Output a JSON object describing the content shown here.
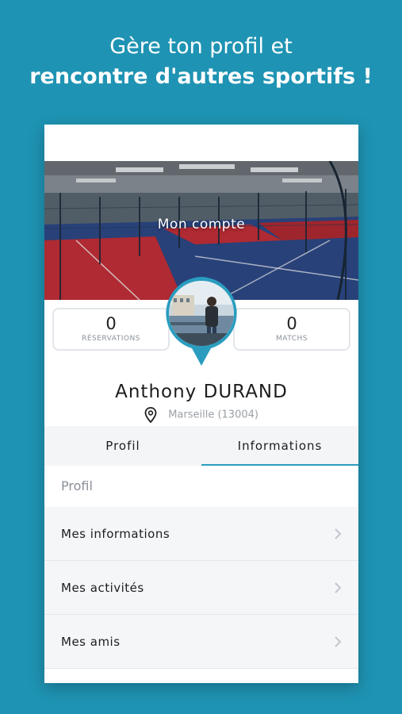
{
  "headline": {
    "line1": "Gère ton profil et",
    "line2": "rencontre d'autres sportifs !"
  },
  "header": {
    "title": "Mon compte"
  },
  "stats": {
    "reservations": {
      "value": "0",
      "label": "RÉSERVATIONS"
    },
    "matchs": {
      "value": "0",
      "label": "MATCHS"
    }
  },
  "profile": {
    "name": "Anthony DURAND",
    "location": "Marseille (13004)"
  },
  "tabs": [
    {
      "label": "Profil",
      "active": false
    },
    {
      "label": "Informations",
      "active": true
    }
  ],
  "section": {
    "title": "Profil"
  },
  "menu": [
    {
      "label": "Mes informations"
    },
    {
      "label": "Mes activités"
    },
    {
      "label": "Mes amis"
    }
  ],
  "colors": {
    "background": "#1f93b3",
    "accent": "#2a9dbf",
    "court_blue": "#2e4a8a",
    "court_red": "#c8303a"
  },
  "icons": {
    "location": "map-pin-icon",
    "chevron": "chevron-right-icon"
  }
}
